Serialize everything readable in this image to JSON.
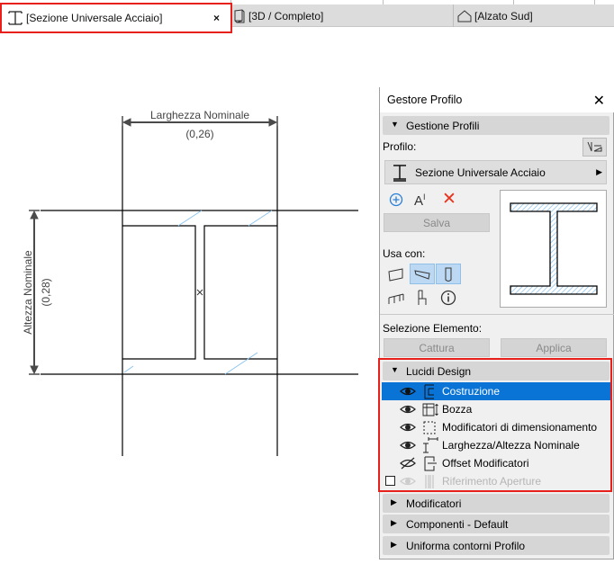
{
  "tabs": [
    {
      "label": "[Sezione Universale Acciaio]",
      "icon": "i-beam-icon",
      "active": true,
      "close": "×"
    },
    {
      "label": "[3D / Completo]",
      "icon": "3d-view-icon"
    },
    {
      "label": "[Alzato Sud]",
      "icon": "elevation-icon"
    }
  ],
  "drawing": {
    "width_label": "Larghezza Nominale",
    "width_value": "(0,26)",
    "height_label": "Altezza Nominale",
    "height_value": "(0,28)"
  },
  "panel": {
    "title": "Gestore Profilo",
    "close": "✕",
    "gestione": {
      "header": "Gestione Profili",
      "profilo_label": "Profilo:",
      "profile_name": "Sezione Universale Acciaio",
      "save": "Salva",
      "usa_con": "Usa con:"
    },
    "selezione": {
      "label": "Selezione Elemento:",
      "capture": "Cattura",
      "apply": "Applica"
    },
    "lucidi": {
      "header": "Lucidi Design",
      "items": [
        {
          "label": "Costruzione",
          "visible": true,
          "selected": true
        },
        {
          "label": "Bozza",
          "visible": true
        },
        {
          "label": "Modificatori di dimensionamento",
          "visible": true
        },
        {
          "label": "Larghezza/Altezza Nominale",
          "visible": true
        },
        {
          "label": "Offset Modificatori",
          "visible": false
        },
        {
          "label": "Riferimento Aperture",
          "visible": true,
          "disabled": true,
          "checked": false
        }
      ]
    },
    "collapsed": [
      "Modificatori",
      "Componenti - Default",
      "Uniforma contorni Profilo"
    ]
  },
  "colors": {
    "highlight": "#e8201c",
    "selection": "#0a74d6",
    "hatch": "#8cc4f0"
  }
}
